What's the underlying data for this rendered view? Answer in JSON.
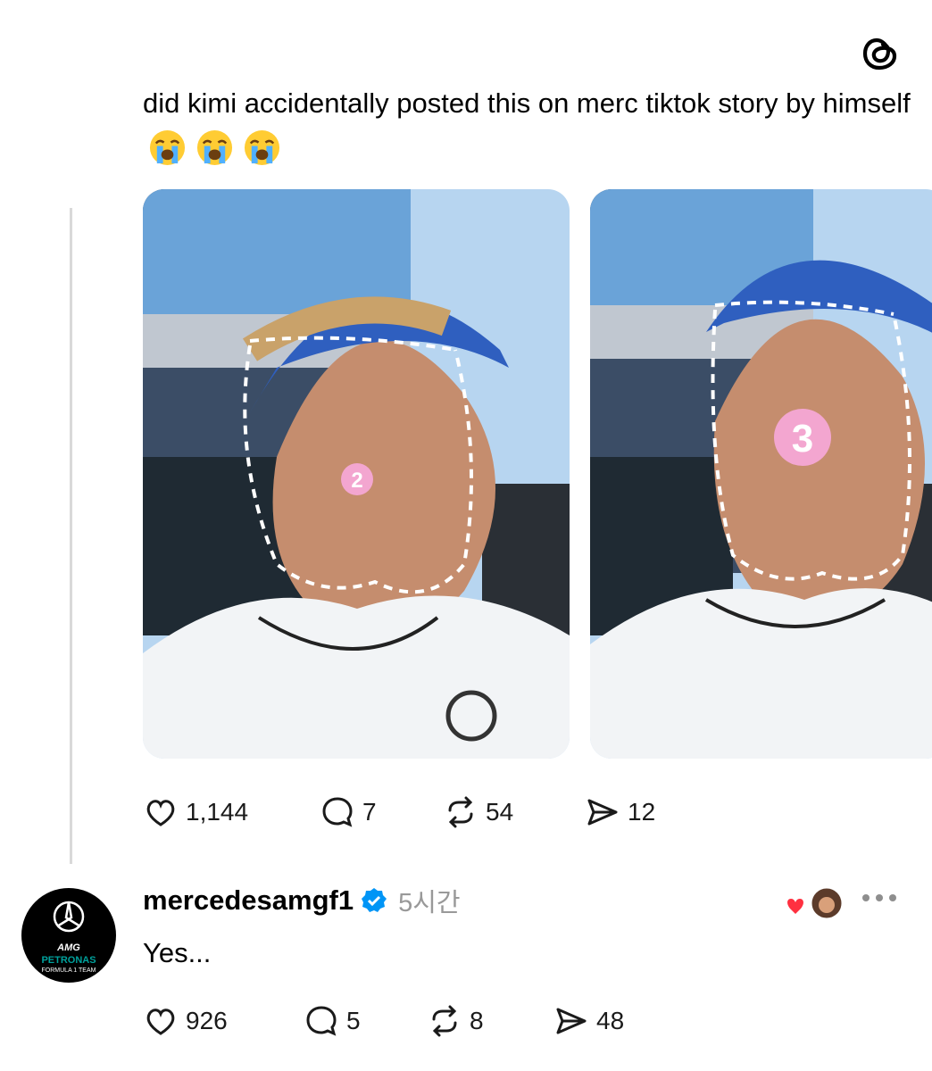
{
  "post": {
    "text": "did kimi accidentally posted this on merc tiktok story by himself",
    "emojis": [
      "loudly-crying-face",
      "loudly-crying-face",
      "loudly-crying-face"
    ],
    "images": [
      {
        "alt": "selfie with sticker 2",
        "sticker": "2"
      },
      {
        "alt": "selfie with sticker 3",
        "sticker": "3"
      }
    ],
    "stats": {
      "likes": "1,144",
      "replies": "7",
      "reposts": "54",
      "shares": "12"
    }
  },
  "reply": {
    "username": "mercedesamgf1",
    "verified": true,
    "time": "5시간",
    "text": "Yes...",
    "avatar": {
      "line1": "AMG",
      "line2": "PETRONAS",
      "line3": "FORMULA 1 TEAM"
    },
    "stats": {
      "likes": "926",
      "replies": "5",
      "reposts": "8",
      "shares": "48"
    }
  },
  "colors": {
    "verified": "#0095f6",
    "like_heart": "#ff3040",
    "petronas": "#00a19c"
  },
  "icons": [
    "threads-logo-icon",
    "heart-icon",
    "comment-icon",
    "repost-icon",
    "share-icon",
    "verified-icon",
    "more-icon"
  ]
}
